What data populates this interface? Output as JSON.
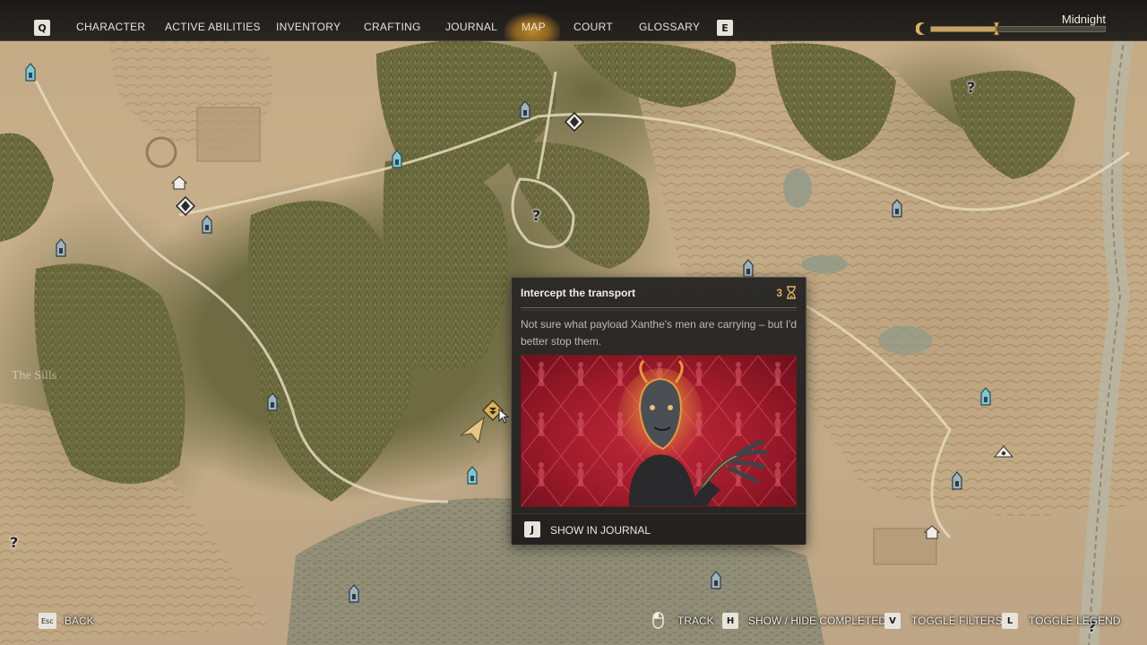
{
  "topbar": {
    "left_key": "Q",
    "right_key": "E",
    "tabs": [
      {
        "label": "CHARACTER"
      },
      {
        "label": "ACTIVE ABILITIES"
      },
      {
        "label": "INVENTORY"
      },
      {
        "label": "CRAFTING"
      },
      {
        "label": "JOURNAL"
      },
      {
        "label": "MAP"
      },
      {
        "label": "COURT"
      },
      {
        "label": "GLOSSARY"
      }
    ],
    "active_tab": "MAP",
    "time_of_day": "Midnight",
    "time_icon": "crescent-moon-icon",
    "time_progress": 0.38
  },
  "map": {
    "region_label": "The Sills",
    "colors": {
      "parchment": "#c4ab86",
      "forest": "#6b6a3e",
      "marker_blue": "#7fc6d6",
      "quest_gold": "#d9b360"
    }
  },
  "popup": {
    "title": "Intercept the transport",
    "count": "3",
    "count_icon": "hourglass-icon",
    "description": "Not sure what payload Xanthe's men are carrying – but I'd better stop them.",
    "image_alt": "red-patterned-wall-portrait-image",
    "footer_key": "J",
    "footer_label": "SHOW IN JOURNAL"
  },
  "bottombar": {
    "back_key": "Esc",
    "back_label": "BACK",
    "track_label": "TRACK",
    "completed_key": "H",
    "completed_label": "SHOW / HIDE COMPLETED",
    "filters_key": "V",
    "filters_label": "TOGGLE FILTERS",
    "legend_key": "L",
    "legend_label": "TOGGLE LEGEND"
  }
}
